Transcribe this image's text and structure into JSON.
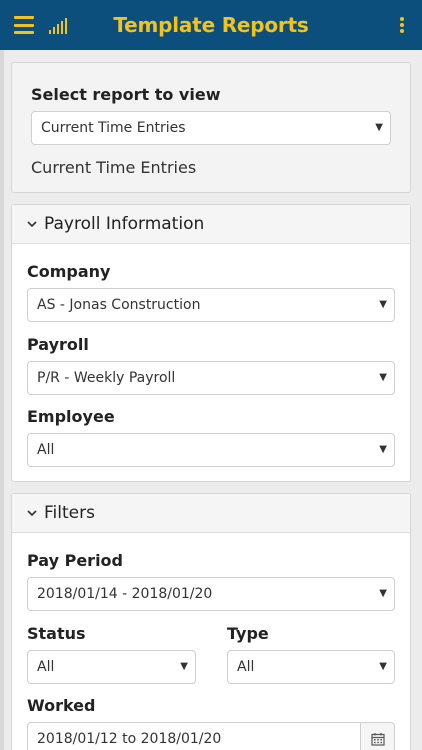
{
  "header": {
    "title": "Template Reports",
    "accent_color": "#f3c31b",
    "bar_color": "#0c4f7c",
    "menu_icon": "hamburger-menu-icon",
    "signal_icon": "signal-bars-icon",
    "more_icon": "vertical-ellipsis-icon"
  },
  "report_select": {
    "label": "Select report to view",
    "value": "Current Time Entries",
    "current_text": "Current Time Entries"
  },
  "payroll_section": {
    "title": "Payroll Information",
    "company_label": "Company",
    "company_value": "AS - Jonas Construction",
    "payroll_label": "Payroll",
    "payroll_value": "P/R - Weekly Payroll",
    "employee_label": "Employee",
    "employee_value": "All"
  },
  "filters_section": {
    "title": "Filters",
    "pay_period_label": "Pay Period",
    "pay_period_value": "2018/01/14 - 2018/01/20",
    "status_label": "Status",
    "status_value": "All",
    "type_label": "Type",
    "type_value": "All",
    "worked_label": "Worked",
    "worked_value": "2018/01/12 to 2018/01/20"
  }
}
